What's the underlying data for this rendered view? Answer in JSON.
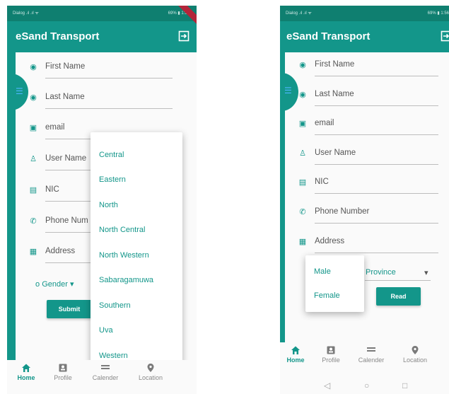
{
  "app": {
    "title": "eSand Transport",
    "status_left": "Dialog  .ıl .ıl ᯤ",
    "status_right": "69% ▮ 1:56"
  },
  "left": {
    "fields": [
      {
        "label": "First Name",
        "icon": "person-circle-icon"
      },
      {
        "label": "Last Name",
        "icon": "person-circle-icon"
      },
      {
        "label": "email",
        "icon": "contact-icon"
      },
      {
        "label": "User Name",
        "icon": "person-icon"
      },
      {
        "label": "NIC",
        "icon": "id-card-icon"
      },
      {
        "label": "Phone Num",
        "icon": "phone-icon"
      },
      {
        "label": "Address",
        "icon": "address-icon"
      }
    ],
    "gender_label": "Gender",
    "submit_label": "Submit",
    "province_options": [
      "Central",
      "Eastern",
      "North",
      "North Central",
      "North Western",
      "Sabaragamuwa",
      "Southern",
      "Uva",
      "Western"
    ]
  },
  "right": {
    "fields": [
      {
        "label": "First Name",
        "icon": "person-circle-icon"
      },
      {
        "label": "Last Name",
        "icon": "person-circle-icon"
      },
      {
        "label": "email",
        "icon": "contact-icon"
      },
      {
        "label": "User Name",
        "icon": "person-icon"
      },
      {
        "label": "NIC",
        "icon": "id-card-icon"
      },
      {
        "label": "Phone Number",
        "icon": "phone-icon"
      },
      {
        "label": "Address",
        "icon": "address-icon"
      }
    ],
    "gender_options": [
      "Male",
      "Female"
    ],
    "province_label": "Province",
    "read_label": "Read"
  },
  "nav": [
    {
      "label": "Home",
      "icon": "home-icon"
    },
    {
      "label": "Profile",
      "icon": "profile-icon"
    },
    {
      "label": "Calender",
      "icon": "calendar-icon"
    },
    {
      "label": "Location",
      "icon": "location-icon"
    }
  ],
  "colors": {
    "primary": "#13968a",
    "status": "#0f7f70",
    "hamburger": "#4db6ff"
  }
}
